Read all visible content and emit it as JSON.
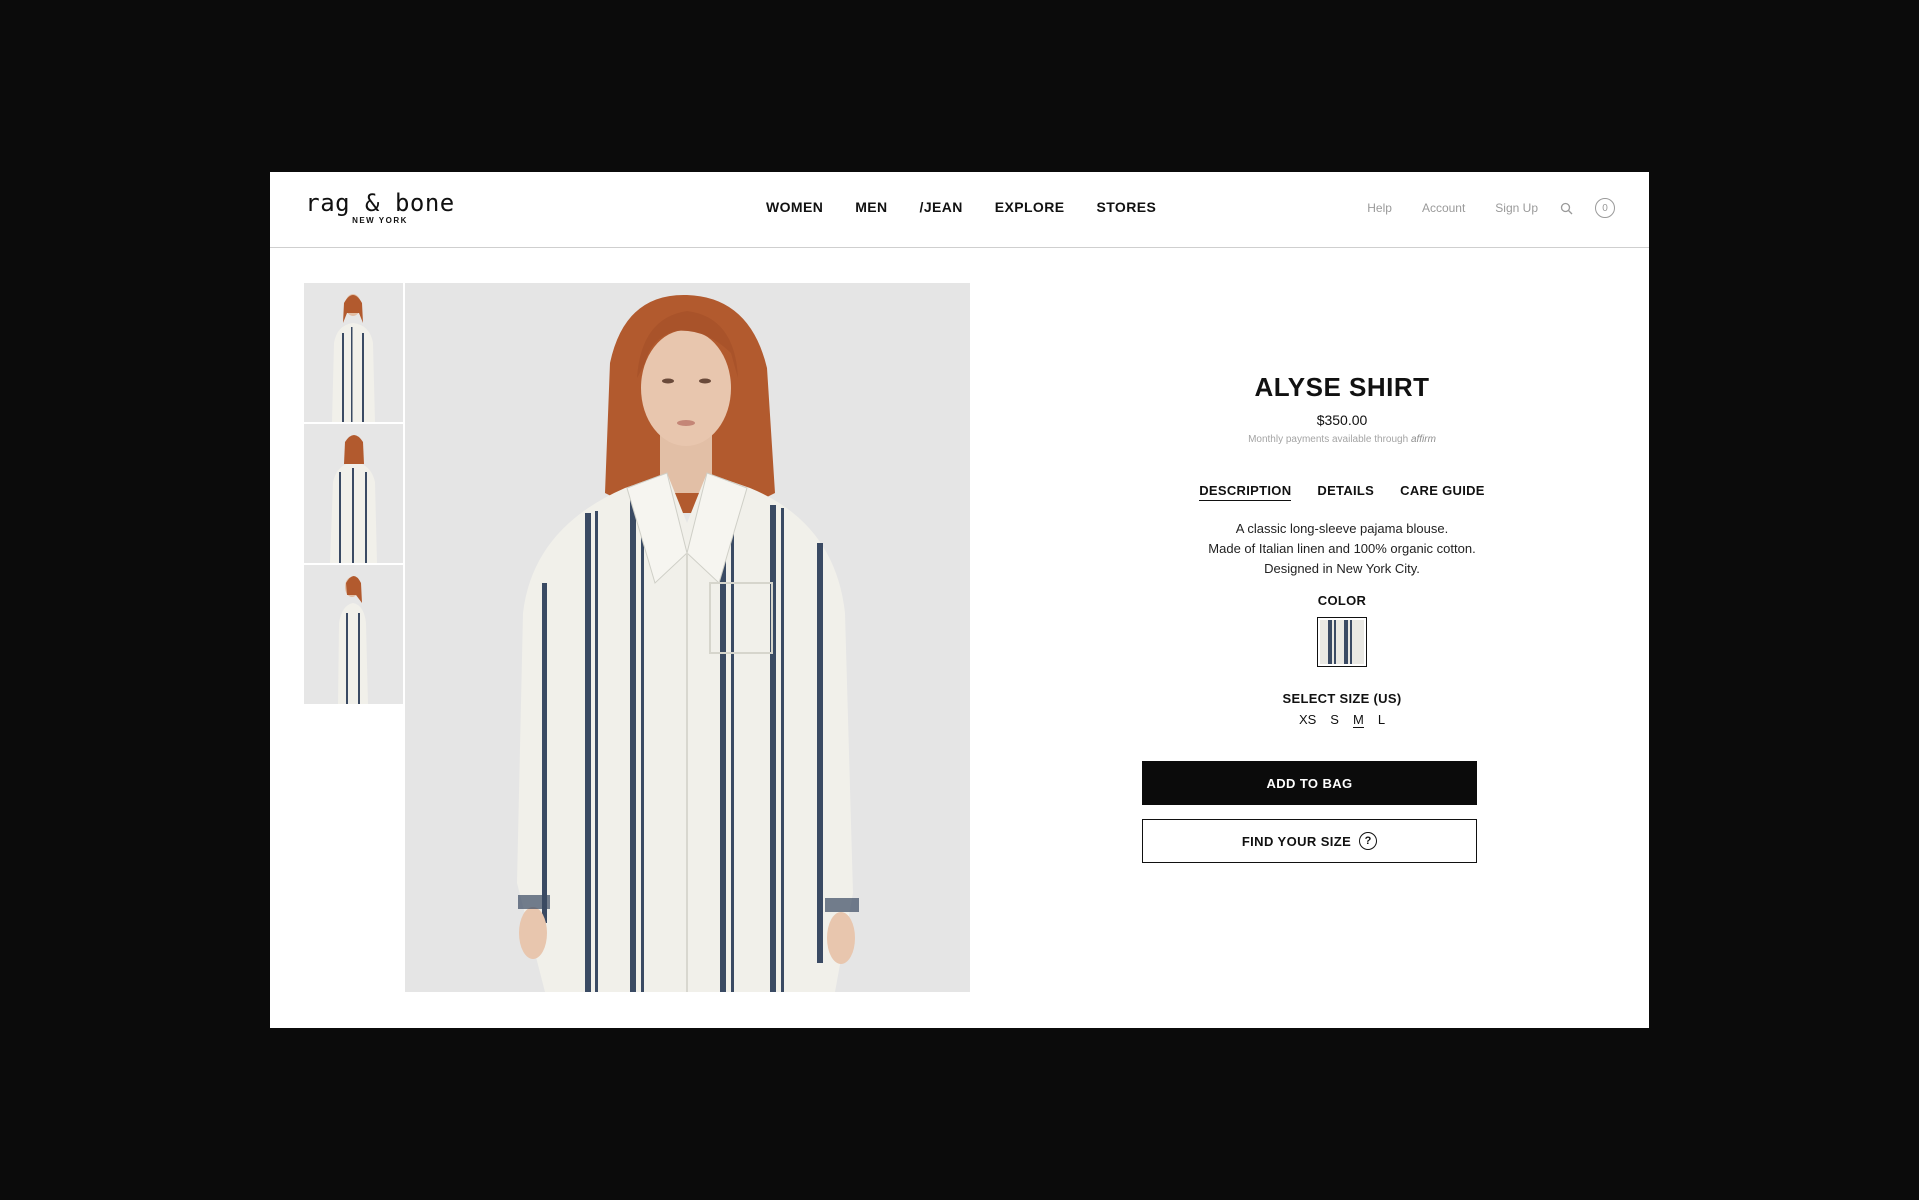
{
  "header": {
    "logo_main": "rag & bone",
    "logo_sub": "NEW YORK",
    "nav": [
      "WOMEN",
      "MEN",
      "/JEAN",
      "EXPLORE",
      "STORES"
    ],
    "utility": [
      "Help",
      "Account",
      "Sign Up"
    ],
    "bag_count": "0"
  },
  "product": {
    "title": "ALYSE SHIRT",
    "price": "$350.00",
    "affirm_text": "Monthly payments available through",
    "affirm_brand": "affirm",
    "tabs": [
      "DESCRIPTION",
      "DETAILS",
      "CARE GUIDE"
    ],
    "active_tab": "DESCRIPTION",
    "description": [
      "A classic long-sleeve pajama blouse.",
      "Made of Italian linen and 100% organic cotton.",
      "Designed in New York City."
    ],
    "color_label": "COLOR",
    "size_label": "SELECT SIZE (US)",
    "sizes": [
      "XS",
      "S",
      "M",
      "L"
    ],
    "selected_size": "M",
    "add_to_bag": "ADD TO BAG",
    "find_size": "FIND YOUR SIZE",
    "find_size_icon": "?"
  },
  "colors": {
    "background": "#0b0b0b",
    "stripe": "#3a4a63",
    "shirt": "#f1f0ea",
    "hair": "#b25a2e"
  }
}
